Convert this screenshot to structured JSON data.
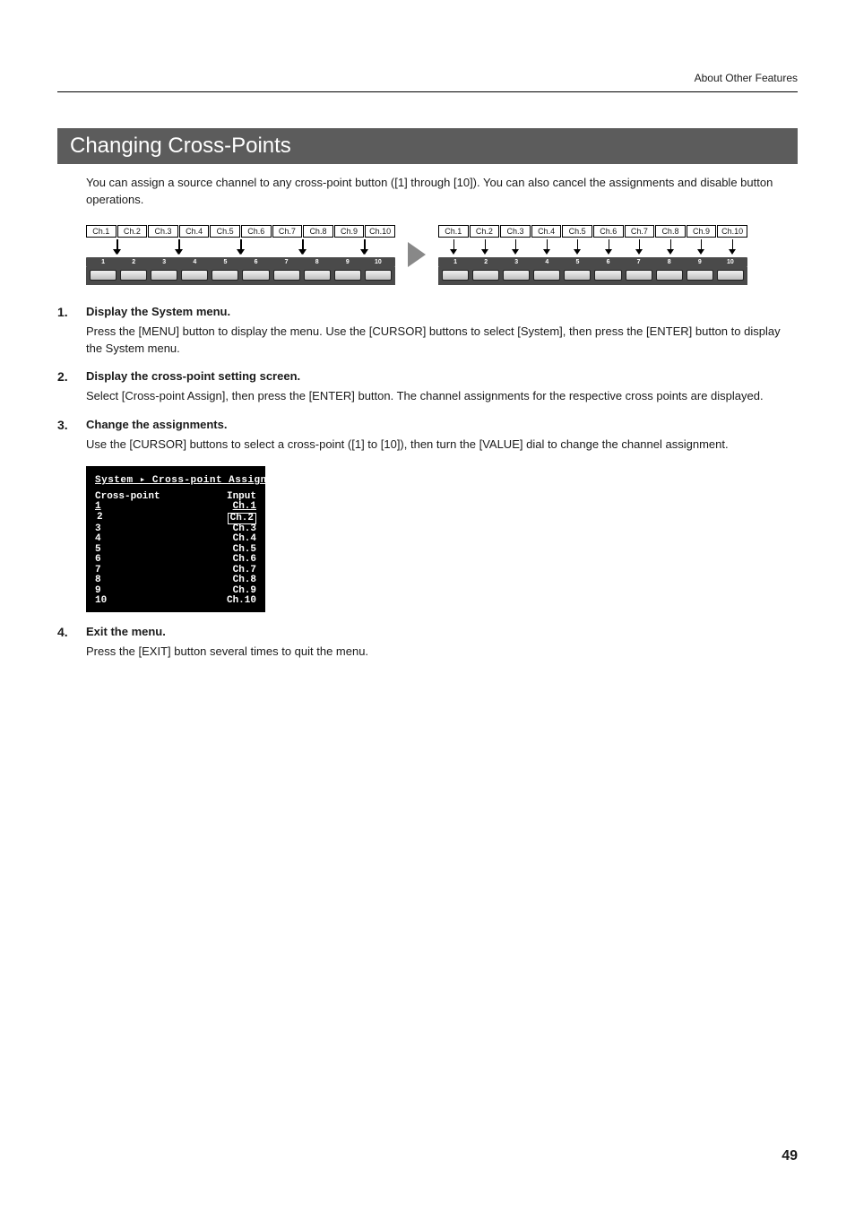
{
  "header": {
    "breadcrumb": "About Other Features"
  },
  "section_title": "Changing Cross-Points",
  "intro": "You can assign a source channel to any cross-point button ([1] through [10]). You can also cancel the assignments and disable button operations.",
  "diagram": {
    "channel_labels": [
      "Ch.1",
      "Ch.2",
      "Ch.3",
      "Ch.4",
      "Ch.5",
      "Ch.6",
      "Ch.7",
      "Ch.8",
      "Ch.9",
      "Ch.10"
    ],
    "button_numbers": [
      "1",
      "2",
      "3",
      "4",
      "5",
      "6",
      "7",
      "8",
      "9",
      "10"
    ]
  },
  "steps": [
    {
      "num": "1.",
      "title": "Display the System menu.",
      "body": "Press the [MENU] button to display the menu. Use the [CURSOR] buttons to select [System], then press the [ENTER] button to display the System menu."
    },
    {
      "num": "2.",
      "title": "Display the cross-point setting screen.",
      "body": "Select [Cross-point Assign], then press the [ENTER] button. The channel assignments for the respective cross points are displayed."
    },
    {
      "num": "3.",
      "title": "Change the assignments.",
      "body": "Use the [CURSOR] buttons to select a cross-point ([1] to [10]), then turn the [VALUE] dial to change the channel assignment."
    },
    {
      "num": "4.",
      "title": "Exit the menu.",
      "body": "Press the [EXIT] button several times to quit the menu."
    }
  ],
  "menu_screen": {
    "title": "System ▸ Cross-point Assign",
    "col_left": "Cross-point",
    "col_right": "Input",
    "rows": [
      {
        "cp": "1",
        "inp": "Ch.1",
        "underlined": true
      },
      {
        "cp": "2",
        "inp": "Ch.2",
        "selected": true
      },
      {
        "cp": "3",
        "inp": "Ch.3"
      },
      {
        "cp": "4",
        "inp": "Ch.4"
      },
      {
        "cp": "5",
        "inp": "Ch.5"
      },
      {
        "cp": "6",
        "inp": "Ch.6"
      },
      {
        "cp": "7",
        "inp": "Ch.7"
      },
      {
        "cp": "8",
        "inp": "Ch.8"
      },
      {
        "cp": "9",
        "inp": "Ch.9"
      },
      {
        "cp": "10",
        "inp": "Ch.10"
      }
    ]
  },
  "page_number": "49"
}
